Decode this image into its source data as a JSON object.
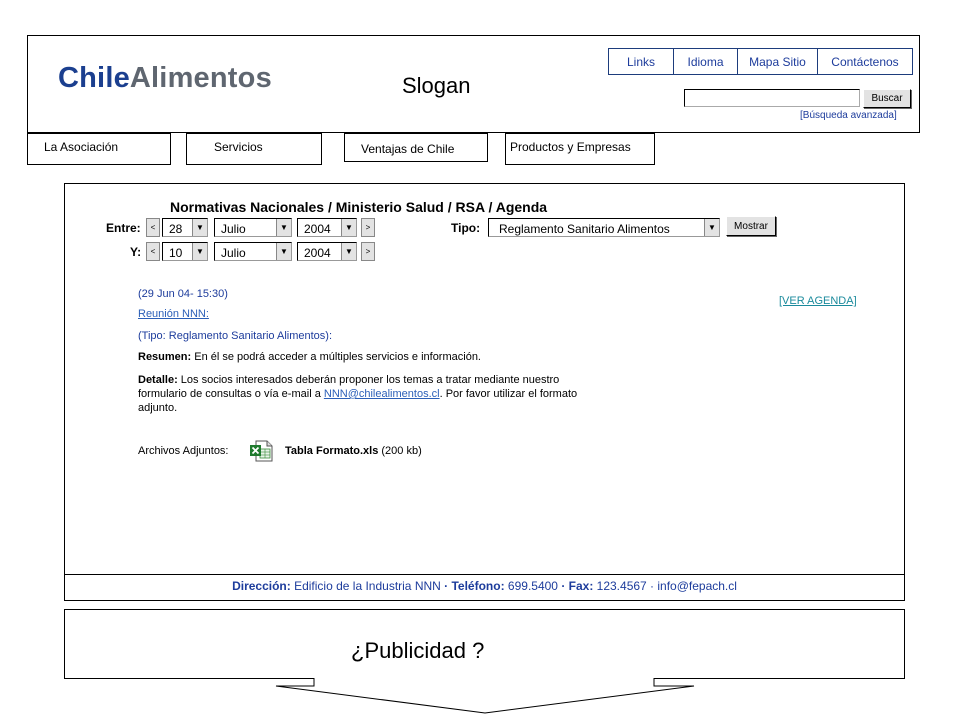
{
  "logo": {
    "part1": "Chile",
    "part2": "Alimentos"
  },
  "slogan": "Slogan",
  "top_links": [
    "Links",
    "Idioma",
    "Mapa Sitio",
    "Contáctenos"
  ],
  "search": {
    "value": "",
    "button_label": "Buscar",
    "advanced_label": "[Búsqueda avanzada]"
  },
  "nav": {
    "asociacion": "La Asociación",
    "servicios": "Servicios",
    "ventajas": "Ventajas de Chile",
    "productos": "Productos y Empresas"
  },
  "main": {
    "title": "Normativas Nacionales / Ministerio  Salud / RSA / Agenda",
    "filters": {
      "entre_label": "Entre:",
      "y_label": "Y:",
      "tipo_label": "Tipo:",
      "prev": "<",
      "next": ">",
      "from": {
        "day": "28",
        "month": "Julio",
        "year": "2004"
      },
      "to": {
        "day": "10",
        "month": "Julio",
        "year": "2004"
      },
      "tipo_value": "Reglamento Sanitario Alimentos",
      "mostrar_label": "Mostrar"
    },
    "event": {
      "datetime": "(29 Jun 04- 15:30)",
      "title": "Reunión NNN:",
      "tipo": "(Tipo: Reglamento Sanitario Alimentos):",
      "resumen_label": "Resumen:",
      "resumen_text": " En él se podrá acceder a múltiples servicios e información.",
      "detalle_label": "Detalle:",
      "detalle_text1": " Los socios interesados deberán proponer los temas a tratar mediante nuestro",
      "detalle_text2_pre": "formulario de consultas o vía e-mail a ",
      "detalle_email": "NNN@chilealimentos.cl",
      "detalle_text2_post": ". Por favor utilizar el formato",
      "detalle_text3": "adjunto.",
      "adjuntos_label": "Archivos Adjuntos:",
      "file_name": "Tabla Formato.xls",
      "file_size": " (200 kb)"
    },
    "ver_agenda": "[VER AGENDA]"
  },
  "footer": {
    "direccion_label": "Dirección:",
    "direccion": " Edificio de la Industria NNN ",
    "telefono_label": "· Teléfono:",
    "telefono": " 699.5400 ",
    "fax_label": "· Fax:",
    "fax": " 123.4567 ",
    "email": "· info@fepach.cl"
  },
  "ad": {
    "text": "¿Publicidad ?"
  },
  "icons": {
    "excel": "excel-file-icon"
  }
}
